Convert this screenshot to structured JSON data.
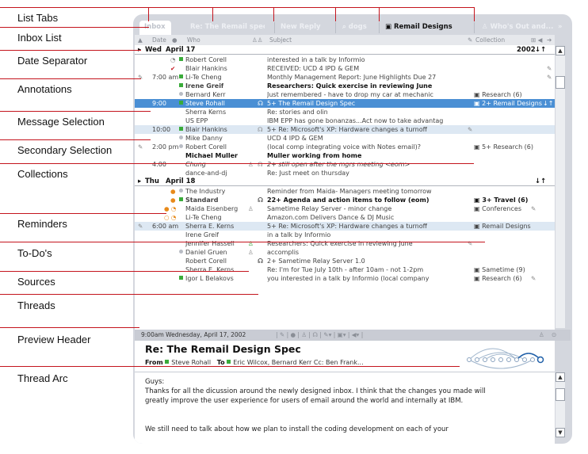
{
  "annotations": [
    "List Tabs",
    "Inbox List",
    "Date Separator",
    "Annotations",
    "Message Selection",
    "Secondary Selection",
    "Collections",
    "Reminders",
    "To-Do's",
    "Sources",
    "Threads",
    "Preview Header",
    "Thread Arc"
  ],
  "tabs": [
    "Inbox",
    "Re: The Remail spec",
    "New Reply",
    "dogs",
    "Remail Designs",
    "Who's Out and..."
  ],
  "tabs_more": "»",
  "columns": {
    "date": "Date",
    "who": "Who",
    "subject": "Subject",
    "collection": "Collection"
  },
  "separators": {
    "wed_day": "Wed",
    "wed_date": "April 17",
    "wed_year": "2002",
    "thu_day": "Thu",
    "thu_date": "April 18"
  },
  "rows": [
    {
      "time": "",
      "who": "Robert Corell",
      "subject": "interested in a talk by Informio",
      "coll": ""
    },
    {
      "time": "",
      "who": "Blair Hankins",
      "subject": "RECEIVED: UCD 4 IPD & GEM",
      "coll": ""
    },
    {
      "time": "7:00 am",
      "who": "Li-Te Cheng",
      "subject": "Monthly Management Report: June Highlights Due 27",
      "coll": ""
    },
    {
      "time": "",
      "who": "Irene Greif",
      "subject": "Researchers: Quick exercise in reviewing June",
      "coll": ""
    },
    {
      "time": "",
      "who": "Bernard Kerr",
      "subject": "Just remembered - have to drop my car at mechanic",
      "coll": "Research (6)"
    },
    {
      "time": "9:00",
      "who": "Steve Rohall",
      "subject": "5+ The Remail Design Spec",
      "coll": "2+ Remail Designs"
    },
    {
      "time": "",
      "who": "Sherra Kerns",
      "subject": "Re: stories and olin",
      "coll": ""
    },
    {
      "time": "",
      "who": "US EPP",
      "subject": "IBM EPP has gone bonanzas...Act now to take advantag",
      "coll": ""
    },
    {
      "time": "10:00",
      "who": "Blair Hankins",
      "subject": "5+ Re: Microsoft's XP: Hardware changes a turnoff",
      "coll": ""
    },
    {
      "time": "",
      "who": "Mike Danny",
      "subject": "UCD 4 IPD & GEM",
      "coll": ""
    },
    {
      "time": "2:00 pm",
      "who": "Robert Corell",
      "subject": "(local comp integrating voice with Notes email)?",
      "coll": "5+ Research (6)"
    },
    {
      "time": "",
      "who": "Michael Muller",
      "subject": "Muller working from home",
      "coll": ""
    },
    {
      "time": "4:00",
      "who": "Chung",
      "subject": "2+ still open after the mgrs meeting <eom>",
      "coll": ""
    },
    {
      "time": "",
      "who": "dance-and-dj",
      "subject": "Re: Just meet on thursday",
      "coll": ""
    },
    {
      "time": "",
      "who": "The Industry",
      "subject": "Reminder from Maida- Managers meeting tomorrow",
      "coll": ""
    },
    {
      "time": "",
      "who": "Standard",
      "subject": "22+ Agenda and action items to follow (eom)",
      "coll": "3+ Travel (6)"
    },
    {
      "time": "",
      "who": "Maida Eisenberg",
      "subject": "Sametime Relay Server - minor change",
      "coll": "Conferences"
    },
    {
      "time": "",
      "who": "Li-Te Cheng",
      "subject": "Amazon.com Delivers Dance & DJ Music",
      "coll": ""
    },
    {
      "time": "6:00 am",
      "who": "Sherra E. Kerns",
      "subject": "5+ Re: Microsoft's XP: Hardware changes a turnoff",
      "coll": "Remail Designs"
    },
    {
      "time": "",
      "who": "Irene Greif",
      "subject": "in a talk by Informio",
      "coll": ""
    },
    {
      "time": "",
      "who": "Jennifer Hassell",
      "subject": "Researchers: Quick exercise in reviewing June",
      "coll": ""
    },
    {
      "time": "",
      "who": "Daniel Gruen",
      "subject": "accomplis",
      "coll": ""
    },
    {
      "time": "",
      "who": "Robert Corell",
      "subject": "2+ Sametime Relay Server 1.0",
      "coll": ""
    },
    {
      "time": "",
      "who": "Sherra E. Kerns",
      "subject": "Re: I'm for Tue July 10th - after 10am - not 1-2pm",
      "coll": "Sametime (9)"
    },
    {
      "time": "",
      "who": "Igor L Belakovs",
      "subject": "you interested in a talk by Informio (local company",
      "coll": "Research (6)"
    }
  ],
  "preview_bar": {
    "datetime": "9:00am Wednesday, April 17, 2002"
  },
  "preview": {
    "subject": "Re: The Remail Design Spec",
    "from_label": "From",
    "from": "Steve Rohall",
    "to_label": "To",
    "to": "Eric Wilcox, Bernard Kerr Cc: Ben Frank..."
  },
  "body": {
    "greeting": "Guys:",
    "para1": "Thanks for all the dicussion around the newly designed inbox. I think that the changes you made will greatly improve the user experience for users of email around the world and internally at IBM.",
    "para2": "We still need to talk about how we plan to install the coding development on each of your"
  }
}
